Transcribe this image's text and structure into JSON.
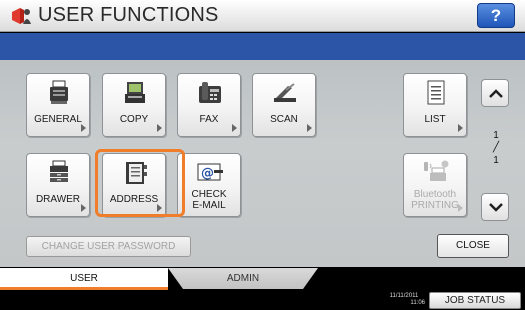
{
  "header": {
    "title": "USER FUNCTIONS",
    "help_label": "?",
    "icon": "user-functions-icon"
  },
  "functions": {
    "general": {
      "label": "GENERAL",
      "icon": "printer-icon"
    },
    "copy": {
      "label": "COPY",
      "icon": "copier-icon"
    },
    "fax": {
      "label": "FAX",
      "icon": "fax-icon"
    },
    "scan": {
      "label": "SCAN",
      "icon": "scanner-icon"
    },
    "list": {
      "label": "LIST",
      "icon": "list-icon"
    },
    "drawer": {
      "label": "DRAWER",
      "icon": "drawer-icon"
    },
    "address": {
      "label": "ADDRESS",
      "icon": "address-book-icon",
      "selected": true
    },
    "check_email": {
      "line1": "CHECK",
      "line2": "E-MAIL",
      "icon": "email-icon"
    },
    "bluetooth": {
      "line1": "Bluetooth",
      "line2": "PRINTING",
      "icon": "bluetooth-printer-icon",
      "enabled": false
    }
  },
  "pager": {
    "current": "1",
    "total": "1"
  },
  "actions": {
    "change_password": "CHANGE USER PASSWORD",
    "close": "CLOSE"
  },
  "tabs": [
    {
      "label": "USER",
      "active": true
    },
    {
      "label": "ADMIN",
      "active": false
    }
  ],
  "status": {
    "date": "11/11/2011",
    "time": "11:06",
    "job_status": "JOB STATUS"
  },
  "colors": {
    "accent": "#ef7d2a",
    "header_blue": "#2c55a8",
    "help_blue": "#1f55b8"
  }
}
